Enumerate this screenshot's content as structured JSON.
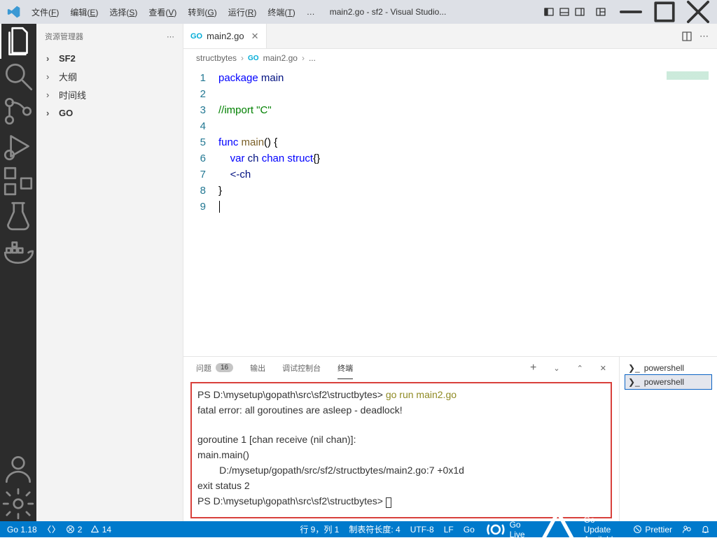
{
  "titlebar": {
    "menus": [
      "文件(F)",
      "编辑(E)",
      "选择(S)",
      "查看(V)",
      "转到(G)",
      "运行(R)",
      "终端(T)"
    ],
    "more": "…",
    "title": "main2.go - sf2 - Visual Studio..."
  },
  "sidebar": {
    "header": "资源管理器",
    "items": [
      {
        "label": "SF2",
        "bold": true
      },
      {
        "label": "大纲",
        "bold": false
      },
      {
        "label": "时间线",
        "bold": false
      },
      {
        "label": "GO",
        "bold": true
      }
    ]
  },
  "tab": {
    "name": "main2.go"
  },
  "breadcrumbs": {
    "a": "structbytes",
    "b": "main2.go",
    "c": "..."
  },
  "code": {
    "lines": [
      "1",
      "2",
      "3",
      "4",
      "5",
      "6",
      "7",
      "8",
      "9"
    ],
    "l1a": "package",
    "l1b": " main",
    "l3a": "//import \"C\"",
    "l5a": "func",
    "l5b": " main",
    "l5c": "() {",
    "l6a": "    ",
    "l6b": "var",
    "l6c": " ch ",
    "l6d": "chan",
    "l6e": " ",
    "l6f": "struct",
    "l6g": "{}",
    "l7": "    <-ch",
    "l8": "}"
  },
  "panel": {
    "tabs": {
      "problems": "问题",
      "problems_count": "16",
      "output": "输出",
      "debug": "调试控制台",
      "terminal": "终端"
    },
    "term": {
      "p1": "PS D:\\mysetup\\gopath\\src\\sf2\\structbytes> ",
      "cmd": "go run main2.go",
      "l2": "fatal error: all goroutines are asleep - deadlock!",
      "l4": "goroutine 1 [chan receive (nil chan)]:",
      "l5": "main.main()",
      "l6": "        D:/mysetup/gopath/src/sf2/structbytes/main2.go:7 +0x1d",
      "l7": "exit status 2",
      "p2": "PS D:\\mysetup\\gopath\\src\\sf2\\structbytes> "
    },
    "termlist": [
      "powershell",
      "powershell"
    ]
  },
  "status": {
    "go": "Go 1.18",
    "errors": "2",
    "warns": "14",
    "pos": "行 9，列 1",
    "tab": "制表符长度: 4",
    "enc": "UTF-8",
    "eol": "LF",
    "lang": "Go",
    "live": "Go Live",
    "update": "Go Update Available",
    "prettier": "Prettier"
  }
}
